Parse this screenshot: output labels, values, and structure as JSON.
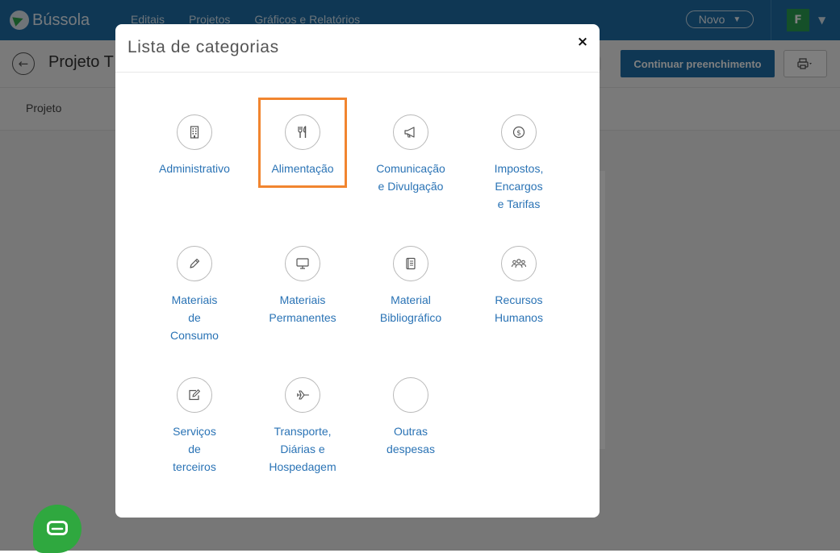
{
  "app": {
    "logo_text": "Bússola",
    "nav": [
      "Editais",
      "Projetos",
      "Gráficos e Relatórios"
    ],
    "novo_label": "Novo",
    "avatar_letter": "F"
  },
  "subbar": {
    "project_title": "Projeto T",
    "continue_label": "Continuar preenchimento"
  },
  "tabs": {
    "projeto": "Projeto"
  },
  "modal": {
    "title": "Lista de categorias",
    "close_symbol": "×",
    "categories": [
      {
        "icon": "building-icon",
        "lines": [
          "Administrativo"
        ]
      },
      {
        "icon": "utensils-icon",
        "lines": [
          "Alimentação"
        ],
        "highlighted": true
      },
      {
        "icon": "megaphone-icon",
        "lines": [
          "Comunicação",
          "e Divulgação"
        ]
      },
      {
        "icon": "dollar-coin-icon",
        "lines": [
          "Impostos,",
          "Encargos",
          "e Tarifas"
        ]
      },
      {
        "icon": "pencil-icon",
        "lines": [
          "Materiais",
          "de",
          "Consumo"
        ]
      },
      {
        "icon": "monitor-icon",
        "lines": [
          "Materiais",
          "Permanentes"
        ]
      },
      {
        "icon": "book-icon",
        "lines": [
          "Material",
          "Bibliográfico"
        ]
      },
      {
        "icon": "people-icon",
        "lines": [
          "Recursos",
          "Humanos"
        ]
      },
      {
        "icon": "edit-document-icon",
        "lines": [
          "Serviços",
          "de",
          "terceiros"
        ]
      },
      {
        "icon": "airplane-icon",
        "lines": [
          "Transporte,",
          "Diárias e",
          "Hospedagem"
        ]
      },
      {
        "icon": "empty-icon",
        "lines": [
          "Outras",
          "despesas"
        ]
      }
    ]
  },
  "colors": {
    "brand_blue": "#1e6fa8",
    "link_blue": "#2a73b5",
    "highlight_orange": "#f1852f",
    "avatar_green": "#2aa052",
    "chat_green": "#2fa83f"
  }
}
